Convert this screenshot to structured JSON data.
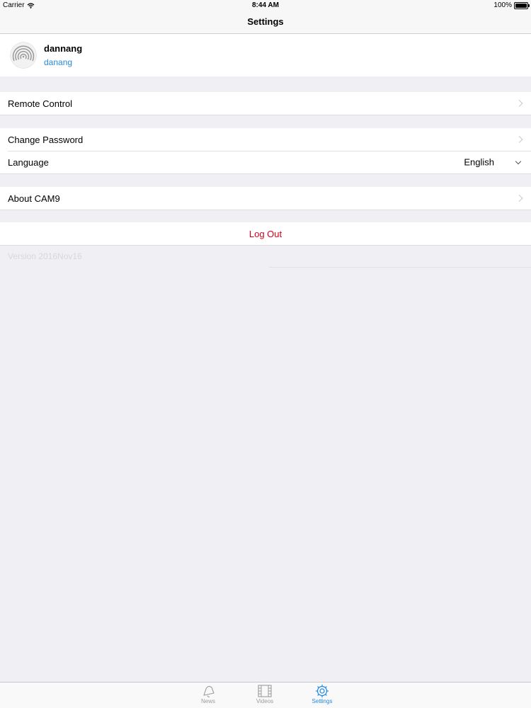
{
  "status_bar": {
    "carrier": "Carrier",
    "time": "8:44 AM",
    "battery": "100%",
    "wifi_icon": "wifi-icon",
    "battery_icon": "battery-icon"
  },
  "nav": {
    "title": "Settings"
  },
  "profile": {
    "name": "dannang",
    "subtitle": "danang",
    "avatar_icon": "broadcast-icon",
    "subtitle_color": "#2a8ad6"
  },
  "sections": {
    "remote_control": "Remote Control",
    "change_password": "Change Password",
    "language_label": "Language",
    "language_value": "English",
    "about": "About CAM9",
    "logout": "Log Out"
  },
  "version": "Version 2016Nov16",
  "colors": {
    "background": "#efeff4",
    "accent": "#1e88e5",
    "destructive": "#d0021b"
  },
  "tabs": [
    {
      "label": "News",
      "icon": "bell-icon",
      "active": false
    },
    {
      "label": "Videos",
      "icon": "film-icon",
      "active": false
    },
    {
      "label": "Settings",
      "icon": "gear-icon",
      "active": true
    }
  ]
}
